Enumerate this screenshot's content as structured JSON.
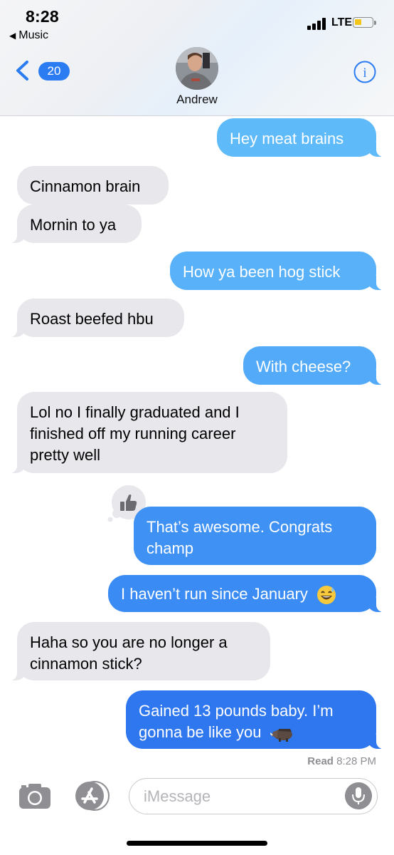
{
  "status_bar": {
    "time": "8:28",
    "back_app": "Music",
    "network": "LTE",
    "battery_color": "#f3c519"
  },
  "header": {
    "unread_count": "20",
    "contact_name": "Andrew",
    "info_icon": "info-icon",
    "back_icon": "chevron-left-icon"
  },
  "colors": {
    "incoming_bubble": "#e7e7ec",
    "outgoing_top": "#5db8fa",
    "outgoing_bottom": "#2b73ee",
    "accent": "#2b7cf3"
  },
  "messages": [
    {
      "direction": "out",
      "text": "Hey meat brains"
    },
    {
      "direction": "in",
      "text": "Cinnamon brain"
    },
    {
      "direction": "in",
      "text": "Mornin to ya"
    },
    {
      "direction": "out",
      "text": "How ya been hog stick"
    },
    {
      "direction": "in",
      "text": "Roast beefed hbu"
    },
    {
      "direction": "out",
      "text": "With cheese?"
    },
    {
      "direction": "in",
      "lines": [
        "Lol no I finally graduated and I",
        "finished off my running career",
        "pretty well"
      ]
    },
    {
      "direction": "out",
      "lines": [
        "That’s awesome. Congrats",
        "champ"
      ],
      "tapback": "thumbs-up-icon"
    },
    {
      "direction": "out",
      "text": "I haven’t run since January",
      "emoji": "grinning-sweat-emoji"
    },
    {
      "direction": "in",
      "lines": [
        "Haha so you are no longer a",
        "cinnamon stick?"
      ]
    },
    {
      "direction": "out",
      "lines": [
        "Gained 13 pounds baby. I’m",
        "gonna be like you"
      ],
      "emoji": "boar-emoji"
    }
  ],
  "read_receipt": {
    "label": "Read",
    "time": "8:28 PM"
  },
  "input_bar": {
    "placeholder": "iMessage",
    "camera_icon": "camera-icon",
    "apps_icon": "app-store-icon",
    "mic_icon": "microphone-icon"
  }
}
